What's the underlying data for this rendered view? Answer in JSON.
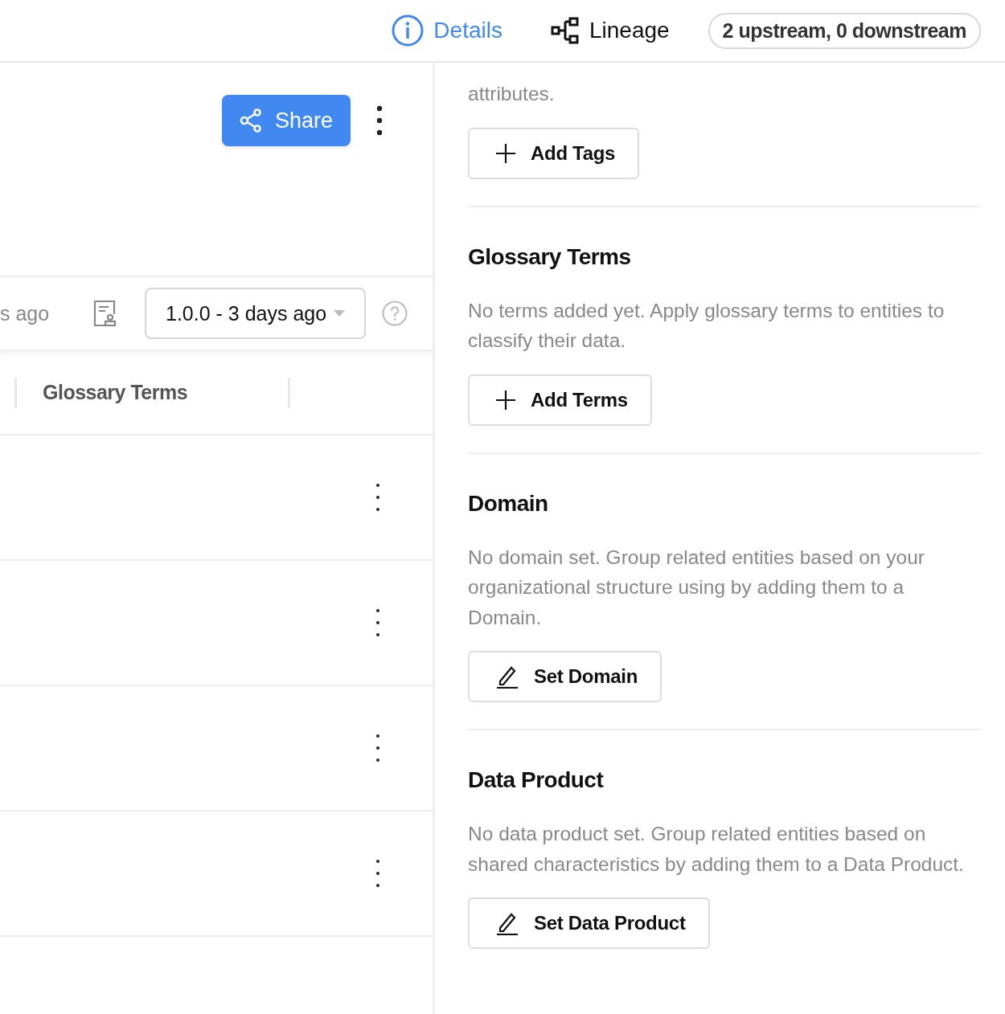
{
  "header": {
    "tabs": [
      {
        "label": "Details",
        "kind": "info",
        "selected": true
      },
      {
        "label": "Lineage",
        "kind": "lineage",
        "selected": false
      }
    ],
    "lineage_summary": "2 upstream, 0 downstream"
  },
  "toolbar": {
    "share_button": "Share"
  },
  "version_bar": {
    "updated": "s ago",
    "version": "1.0.0 - 3 days ago"
  },
  "table": {
    "columns": [
      "Glossary Terms"
    ],
    "rows": [
      {
        "has_menu": true
      },
      {
        "has_menu": true
      },
      {
        "has_menu": true
      },
      {
        "has_menu": true
      }
    ]
  },
  "sidebar": {
    "intro": "attributes.",
    "intro_button": {
      "label": "Add Tags",
      "kind": "add"
    },
    "sections": [
      {
        "title": "Glossary Terms",
        "text": "No terms added yet. Apply glossary terms to entities to classify their data.",
        "button": {
          "label": "Add Terms",
          "kind": "add"
        }
      },
      {
        "title": "Domain",
        "text": "No domain set. Group related entities based on your organizational structure using by adding them to a Domain.",
        "button": {
          "label": "Set Domain",
          "kind": "edit"
        }
      },
      {
        "title": "Data Product",
        "text": "No data product set. Group related entities based on shared characteristics by adding them to a Data Product.",
        "button": {
          "label": "Set Data Product",
          "kind": "edit"
        }
      }
    ]
  }
}
